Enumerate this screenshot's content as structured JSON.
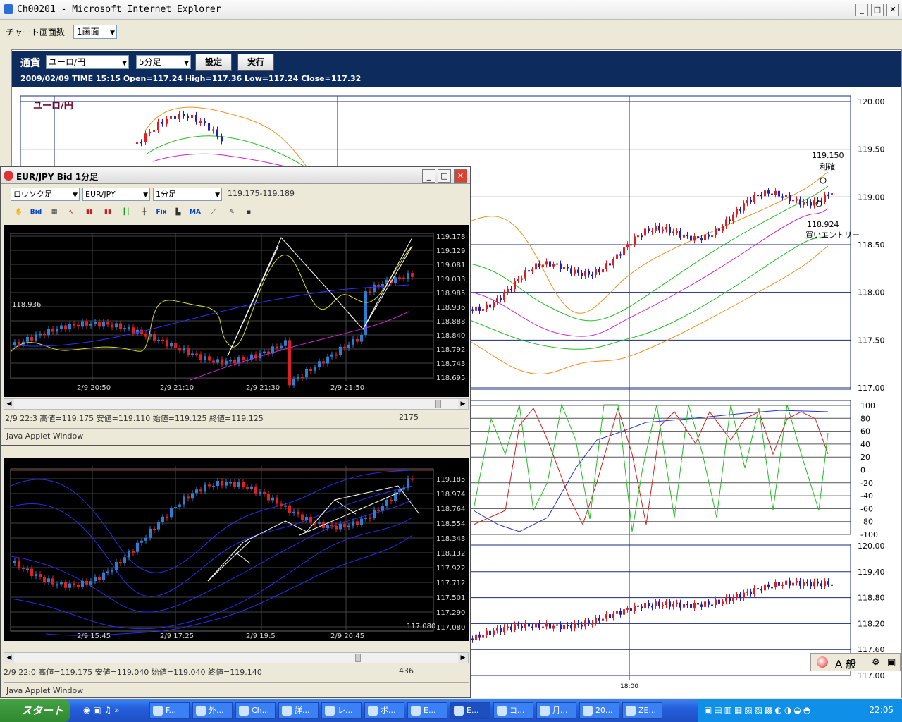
{
  "ie": {
    "title": "Ch00201 - Microsoft Internet Explorer",
    "chart_count_label": "チャート画面数",
    "chart_count_value": "1画面"
  },
  "main": {
    "currency_label": "通貨",
    "currency_value": "ユーロ/円",
    "period_value": "5分足",
    "set_button": "設定",
    "run_button": "実行",
    "ohlc": "2009/02/09  TIME 15:15  Open=117.24  High=117.36  Low=117.24  Close=117.32",
    "panel_label": "ユーロ/円",
    "price_axis": [
      "120.00",
      "119.50",
      "119.00",
      "118.50",
      "118.00",
      "117.50",
      "117.00"
    ],
    "osc_axis": [
      "100",
      "80",
      "60",
      "40",
      "20",
      "0",
      "-20",
      "-40",
      "-60",
      "-80",
      "-100"
    ],
    "lower_axis": [
      "120.00",
      "119.40",
      "118.80",
      "118.20",
      "117.60",
      "117.00"
    ],
    "time_label": "18:00",
    "annotation_tp_price": "119.150",
    "annotation_tp_text": "利確",
    "annotation_entry_price": "118.924",
    "annotation_entry_text": "買いエントリー"
  },
  "win1": {
    "title": "EUR/JPY Bid 1分足",
    "chart_type": "ロウソク足",
    "symbol": "EUR/JPY",
    "period": "1分足",
    "range": "119.175-119.189",
    "price_axis": [
      "119.178",
      "119.129",
      "119.081",
      "119.033",
      "118.985",
      "118.936",
      "118.888",
      "118.840",
      "118.792",
      "118.743",
      "118.695"
    ],
    "current_price": "118.936",
    "time_axis": [
      "2/9 20:50",
      "2/9 21:10",
      "2/9 21:30",
      "2/9 21:50"
    ],
    "status": "2/9 22:3  高値=119.175  安値=119.110  始値=119.125  終値=119.125",
    "count": "2175",
    "applet": "Java Applet Window"
  },
  "win2": {
    "price_axis": [
      "119.185",
      "118.974",
      "118.764",
      "118.554",
      "118.343",
      "118.132",
      "117.922",
      "117.712",
      "117.501",
      "117.290",
      "117.080"
    ],
    "low_label": "117.080",
    "time_axis": [
      "2/9 15:45",
      "2/9 17:25",
      "2/9 19:5",
      "2/9 20:45"
    ],
    "status": "2/9 22:0  高値=119.175  安値=119.040  始値=119.040  終値=119.140",
    "count": "436",
    "applet": "Java Applet Window"
  },
  "ime": {
    "mode": "A 般"
  },
  "taskbar": {
    "start": "スタート",
    "tasks": [
      "F...",
      "外...",
      "Ch...",
      "詳...",
      "レ...",
      "ポ...",
      "E...",
      "E...",
      "コ...",
      "月...",
      "20...",
      "ZE..."
    ],
    "clock": "22:05"
  }
}
